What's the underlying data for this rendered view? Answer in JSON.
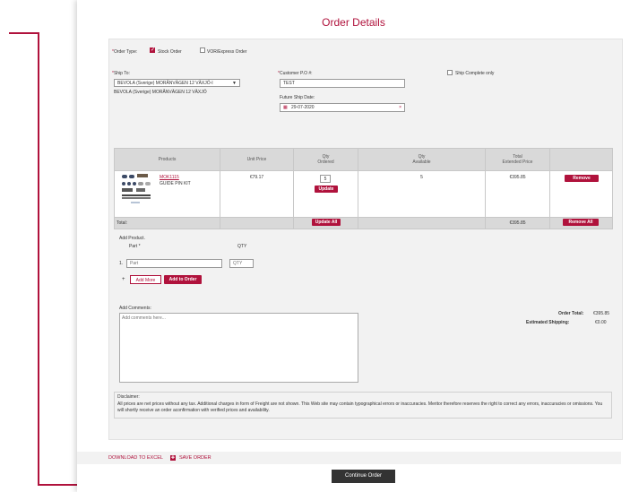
{
  "page": {
    "title": "Order Details"
  },
  "order_type": {
    "label": "Order Type:",
    "stock": "Stock Order",
    "vor": "VOR/Express Order"
  },
  "ship_to": {
    "label": "Ship To:",
    "selected": "BEVOLA (Sverige) MORÅNVÄGEN 12 VÄXJÖ-I",
    "address": "BEVOLA (Sverige) MORÅNVÄGEN 12 VÄXJÖ"
  },
  "customer_po": {
    "label": "Customer P.O #:",
    "value": "TEST"
  },
  "future_ship": {
    "label": "Future Ship Date:",
    "value": "29-07-2020"
  },
  "ship_complete": {
    "label": "Ship Complete only"
  },
  "table": {
    "headers": {
      "products": "Products",
      "unit_price": "Unit Price",
      "qty_ordered_1": "Qty",
      "qty_ordered_2": "Ordered",
      "qty_available_1": "Qty",
      "qty_available_2": "Available",
      "total_1": "Total",
      "total_2": "Extended Price"
    },
    "row": {
      "part_no": "MOK1115",
      "description": "GUIDE PIN KIT",
      "unit_price": "€79.17",
      "qty": "5",
      "available": "5",
      "total": "€395.85",
      "update": "Update",
      "remove": "Remove"
    },
    "footer": {
      "label": "Total:",
      "update_all": "Update All",
      "total": "€395.85",
      "remove_all": "Remove All"
    }
  },
  "add_product": {
    "title": "Add Product.",
    "part_header": "Part ",
    "qty_header": "QTY",
    "row_num": "1.",
    "part_placeholder": "Part",
    "qty_placeholder": "QTY",
    "plus": "+",
    "add_more": "Add More",
    "add_to_order": "Add to Order"
  },
  "comments": {
    "label": "Add Comments:",
    "placeholder": "Add comments here..."
  },
  "totals": {
    "order_total_label": "Order Total:",
    "order_total": "€395.85",
    "shipping_label": "Estimated Shipping:",
    "shipping": "€0.00"
  },
  "disclaimer": {
    "title": "Disclaimer:",
    "text": "All prices are net prices without any tax. Additional charges in form of Freight are not shown. This Web site may contain typographical errors or inaccuracies. Meritor therefore reserves the right to correct any errors, inaccuracies or omissions. You will shortly receive an order aconfirmation with verified prices and availability."
  },
  "links": {
    "download": "DOWNLOAD TO EXCEL",
    "save": "SAVE ORDER"
  },
  "continue": "Continue Order",
  "colors": {
    "accent": "#b0123c",
    "panel": "#f2f2f2",
    "header": "#d9d9d9"
  }
}
